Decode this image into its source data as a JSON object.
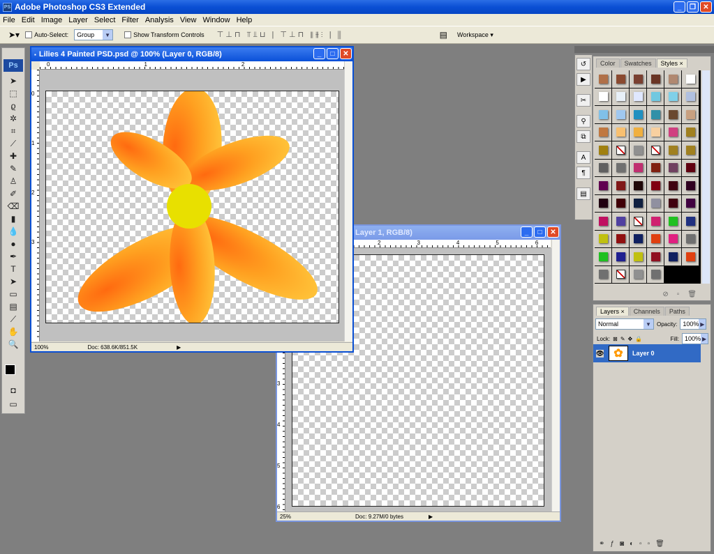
{
  "app": {
    "title": "Adobe Photoshop CS3 Extended",
    "icon": "PS",
    "window_buttons": [
      "minimize",
      "maximize",
      "close"
    ]
  },
  "menu": [
    "File",
    "Edit",
    "Image",
    "Layer",
    "Select",
    "Filter",
    "Analysis",
    "View",
    "Window",
    "Help"
  ],
  "options": {
    "auto_select_label": "Auto-Select:",
    "auto_select_value": "Group",
    "show_transform_label": "Show Transform Controls",
    "workspace_label": "Workspace ▾"
  },
  "toolbox": {
    "logo": "Ps",
    "tools": [
      "move",
      "marquee",
      "lasso",
      "magic-wand",
      "crop",
      "slice",
      "healing",
      "brush",
      "clone-stamp",
      "history-brush",
      "eraser",
      "gradient",
      "blur",
      "dodge",
      "pen",
      "type",
      "path-selection",
      "shape",
      "notes",
      "eyedropper",
      "hand",
      "zoom"
    ]
  },
  "doc1": {
    "title": "Lilies 4 Painted PSD.psd @ 100% (Layer 0, RGB/8)",
    "zoom": "100%",
    "doc_size": "Doc: 638.6K/851.5K",
    "ruler_marks": [
      "0",
      "1",
      "2"
    ],
    "vruler_marks": [
      "0",
      "1",
      "2",
      "3"
    ]
  },
  "doc2": {
    "title": "Layer 1, RGB/8)",
    "zoom": "25%",
    "doc_size": "Doc: 9.27M/0 bytes",
    "ruler_marks": [
      "2",
      "3",
      "4",
      "5",
      "6"
    ],
    "vruler_marks": [
      "3",
      "4",
      "5",
      "6"
    ]
  },
  "styles_panel": {
    "tabs": [
      "Color",
      "Swatches",
      "Styles ×"
    ],
    "active_tab": "Styles ×",
    "swatches": [
      "#b07048",
      "#8a4a30",
      "#7a4030",
      "#6a3525",
      "#b08870",
      "#ffffff",
      "#ffffff",
      "#e8f0f8",
      "#e0e8ff",
      "#70c8e0",
      "#80d0e8",
      "#b0c0e0",
      "#80c0e8",
      "#a0c8f0",
      "#2090c0",
      "#3090a8",
      "#6a4830",
      "#c8a080",
      "#c07840",
      "#f8c070",
      "#f0b040",
      "#f8d0a0",
      "#d04080",
      "#a08020",
      "#a08010",
      "none",
      "#909090",
      "none",
      "#a08020",
      "#a08020",
      "#606060",
      "#707070",
      "#c03070",
      "#802010",
      "#704060",
      "#600010",
      "#600050",
      "#801818",
      "#200808",
      "#800010",
      "#400010",
      "#300020",
      "#200010",
      "#400008",
      "#102040",
      "#9090a0",
      "#400010",
      "#400040",
      "#c01060",
      "#5040a0",
      "none",
      "#d02070",
      "#20c020",
      "#203080",
      "#c0c010",
      "#901010",
      "#102060",
      "#e04010",
      "#e02080",
      "#707070",
      "#20c020",
      "#202090",
      "#c0c010",
      "#901020",
      "#102060",
      "#e04010",
      "#707070",
      "none",
      "#909090",
      "#707070"
    ]
  },
  "layers_panel": {
    "tabs": [
      "Layers ×",
      "Channels",
      "Paths"
    ],
    "active_tab": "Layers ×",
    "blend_mode": "Normal",
    "opacity_label": "Opacity:",
    "opacity": "100%",
    "lock_label": "Lock:",
    "fill_label": "Fill:",
    "fill": "100%",
    "layers": [
      {
        "name": "Layer 0",
        "visible": true,
        "selected": true
      }
    ],
    "footer_icons": [
      "link",
      "fx",
      "mask",
      "adjustment",
      "group",
      "new-layer",
      "delete"
    ]
  }
}
